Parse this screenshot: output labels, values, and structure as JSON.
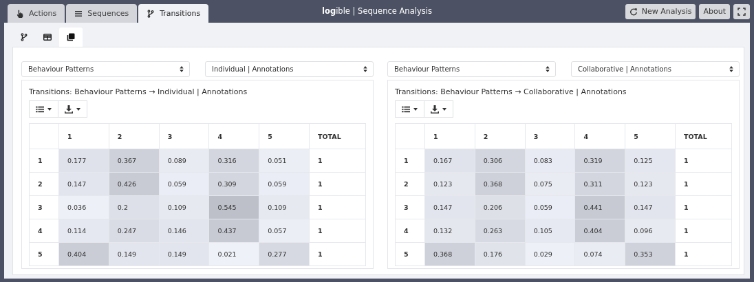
{
  "tabs": [
    {
      "label": "Actions",
      "selected": false
    },
    {
      "label": "Sequences",
      "selected": false
    },
    {
      "label": "Transitions",
      "selected": true
    }
  ],
  "title": "**log**ible | Sequence Analysis",
  "header_buttons": [
    "New Analysis",
    "About"
  ],
  "view_tabs": [
    {
      "selected": false
    },
    {
      "selected": false
    },
    {
      "selected": true
    }
  ],
  "panels": [
    {
      "selects": [
        "Behaviour Patterns",
        "Individual | Annotations"
      ],
      "title": "Transitions: Behaviour Patterns → Individual | Annotations",
      "columns": [
        "1",
        "2",
        "3",
        "4",
        "5",
        "TOTAL"
      ],
      "rows": [
        {
          "label": "1",
          "cells": [
            "0.177",
            "0.367",
            "0.089",
            "0.316",
            "0.051",
            "1"
          ]
        },
        {
          "label": "2",
          "cells": [
            "0.147",
            "0.426",
            "0.059",
            "0.309",
            "0.059",
            "1"
          ]
        },
        {
          "label": "3",
          "cells": [
            "0.036",
            "0.2",
            "0.109",
            "0.545",
            "0.109",
            "1"
          ]
        },
        {
          "label": "4",
          "cells": [
            "0.114",
            "0.247",
            "0.146",
            "0.437",
            "0.057",
            "1"
          ]
        },
        {
          "label": "5",
          "cells": [
            "0.404",
            "0.149",
            "0.149",
            "0.021",
            "0.277",
            "1"
          ]
        }
      ]
    },
    {
      "selects": [
        "Behaviour Patterns",
        "Collaborative | Annotations"
      ],
      "title": "Transitions: Behaviour Patterns → Collaborative | Annotations",
      "columns": [
        "1",
        "2",
        "3",
        "4",
        "5",
        "TOTAL"
      ],
      "rows": [
        {
          "label": "1",
          "cells": [
            "0.167",
            "0.306",
            "0.083",
            "0.319",
            "0.125",
            "1"
          ]
        },
        {
          "label": "2",
          "cells": [
            "0.123",
            "0.368",
            "0.075",
            "0.311",
            "0.123",
            "1"
          ]
        },
        {
          "label": "3",
          "cells": [
            "0.147",
            "0.206",
            "0.059",
            "0.441",
            "0.147",
            "1"
          ]
        },
        {
          "label": "4",
          "cells": [
            "0.132",
            "0.263",
            "0.105",
            "0.404",
            "0.096",
            "1"
          ]
        },
        {
          "label": "5",
          "cells": [
            "0.368",
            "0.176",
            "0.029",
            "0.074",
            "0.353",
            "1"
          ]
        }
      ]
    }
  ]
}
